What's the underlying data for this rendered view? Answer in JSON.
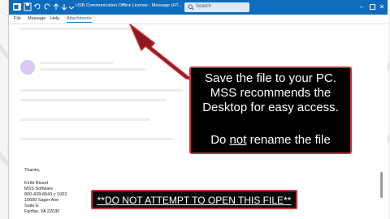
{
  "window": {
    "title": "USB Communication Offline License - Message (HT...",
    "search_placeholder": "Search"
  },
  "ribbon": {
    "tabs": [
      "File",
      "Message",
      "Help",
      "Attachments"
    ],
    "active_tab": "Attachments"
  },
  "signature": {
    "lines": [
      "Thanks,",
      "",
      "Kirthi Bisset",
      "MSS Software",
      "800-428-8643 x 1003",
      "10600 Sager Ave",
      "Suite E",
      "Fairfax, VA 22030"
    ]
  },
  "callout": {
    "line1": "Save the file to your PC.",
    "line2": "MSS recommends the",
    "line3": "Desktop for easy access.",
    "do": "Do ",
    "not": "not",
    "rest": " rename the file"
  },
  "banner": {
    "text": "**DO NOT ATTEMPT TO OPEN THIS FILE**"
  },
  "colors": {
    "titlebar": "#0f6cbd",
    "callout_border": "#c8323a",
    "arrow": "#c8323a"
  }
}
